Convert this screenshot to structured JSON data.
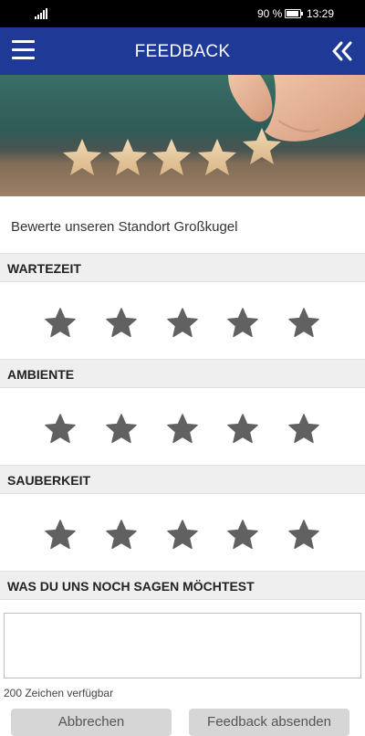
{
  "status_bar": {
    "battery_percent": "90 %",
    "battery_level": 0.9,
    "time": "13:29"
  },
  "header": {
    "title": "FEEDBACK",
    "menu_icon": "hamburger-menu-icon",
    "back_icon": "double-chevron-left-icon"
  },
  "hero": {
    "description_icon": "five-wooden-stars-photo"
  },
  "intro_text": "Bewerte unseren Standort Großkugel",
  "sections": [
    {
      "label": "WARTEZEIT",
      "rating": 0,
      "max": 5
    },
    {
      "label": "AMBIENTE",
      "rating": 0,
      "max": 5
    },
    {
      "label": "SAUBERKEIT",
      "rating": 0,
      "max": 5
    }
  ],
  "comment_section": {
    "label": "WAS DU UNS NOCH SAGEN MÖCHTEST",
    "value": "",
    "placeholder": ""
  },
  "counter_text": "200 Zeichen verfügbar",
  "buttons": {
    "cancel": "Abbrechen",
    "submit": "Feedback absenden"
  },
  "colors": {
    "header_bg": "#1e3a96",
    "star": "#616161",
    "section_bg": "#efefef"
  }
}
